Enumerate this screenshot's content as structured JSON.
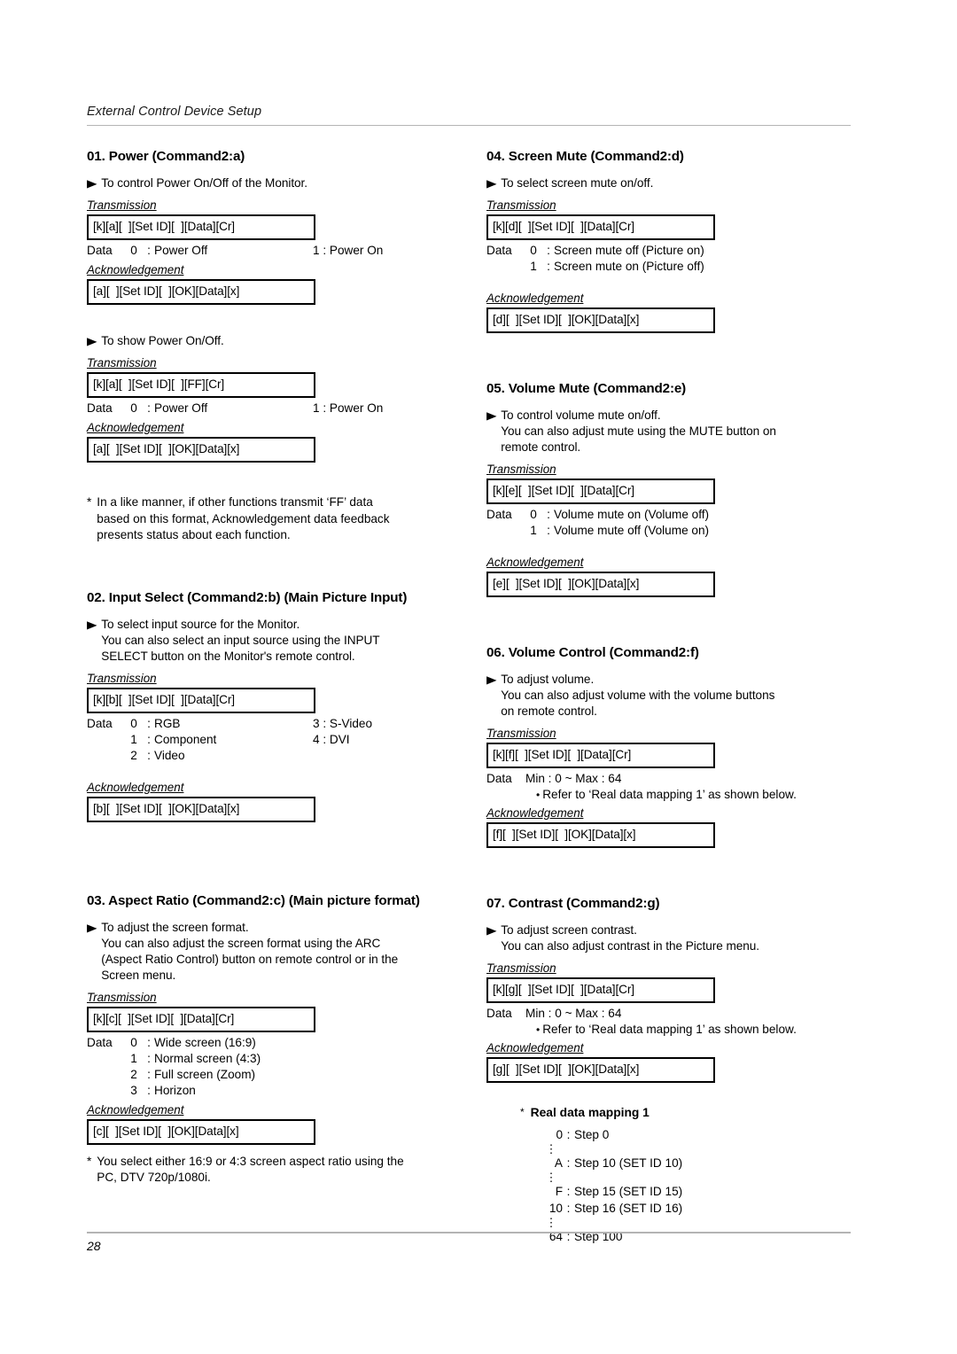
{
  "header": {
    "title": "External Control Device Setup"
  },
  "footer": {
    "page_number": "28"
  },
  "labels": {
    "transmission": "Transmission",
    "acknowledgement": "Acknowledgement",
    "data": "Data",
    "triangle_bullet": "▶",
    "dot_bullet": "•",
    "asterisk": "*",
    "vertical_ellipsis": "⋮"
  },
  "sections": [
    {
      "id": "01",
      "title": "01. Power (Command2:a)",
      "blocks": [
        {
          "intro": [
            "To control Power On/Off of the Monitor."
          ],
          "transmission": "[k][a][  ][Set ID][  ][Data][Cr]",
          "data_label": "Data",
          "data_rows": [
            {
              "key": "0",
              "colon": ":",
              "value": "Power Off",
              "key2": "1",
              "colon2": ":",
              "value2": "Power On"
            }
          ],
          "acknowledgement": "[a][  ][Set ID][  ][OK][Data][x]"
        },
        {
          "intro": [
            "To show Power On/Off."
          ],
          "transmission": "[k][a][  ][Set ID][  ][FF][Cr]",
          "data_label": "Data",
          "data_rows": [
            {
              "key": "0",
              "colon": ":",
              "value": "Power Off",
              "key2": "1",
              "colon2": ":",
              "value2": "Power On"
            }
          ],
          "acknowledgement": "[a][  ][Set ID][  ][OK][Data][x]"
        }
      ],
      "note": {
        "marker": "*",
        "lines": [
          "In a like manner, if other functions transmit ‘FF’ data",
          "based on this format, Acknowledgement data feedback",
          "presents status about each function."
        ]
      }
    },
    {
      "id": "02",
      "title": "02. Input Select (Command2:b) (Main Picture Input)",
      "blocks": [
        {
          "intro": [
            "To select input source for the Monitor.",
            "You can also select an input source using the INPUT",
            "SELECT button on the Monitor's remote control."
          ],
          "transmission": "[k][b][  ][Set ID][  ][Data][Cr]",
          "data_label": "Data",
          "data_rows": [
            {
              "key": "0",
              "colon": ":",
              "value": "RGB",
              "key2": "3",
              "colon2": ":",
              "value2": "S-Video"
            },
            {
              "key": "1",
              "colon": ":",
              "value": "Component",
              "key2": "4",
              "colon2": ":",
              "value2": "DVI"
            },
            {
              "key": "2",
              "colon": ":",
              "value": "Video"
            }
          ],
          "acknowledgement": "[b][  ][Set ID][  ][OK][Data][x]"
        }
      ]
    },
    {
      "id": "03",
      "title": "03. Aspect Ratio (Command2:c) (Main picture format)",
      "blocks": [
        {
          "intro": [
            "To adjust the screen format.",
            "You can also adjust the screen format using the ARC",
            "(Aspect Ratio Control) button on remote control or in the",
            "Screen menu."
          ],
          "transmission": "[k][c][  ][Set ID][  ][Data][Cr]",
          "data_label": "Data",
          "data_rows": [
            {
              "key": "0",
              "colon": ":",
              "value": "Wide screen (16:9)"
            },
            {
              "key": "1",
              "colon": ":",
              "value": "Normal screen (4:3)"
            },
            {
              "key": "2",
              "colon": ":",
              "value": "Full screen (Zoom)"
            },
            {
              "key": "3",
              "colon": ":",
              "value": "Horizon"
            }
          ],
          "acknowledgement": "[c][  ][Set ID][  ][OK][Data][x]"
        }
      ],
      "note": {
        "marker": "*",
        "lines": [
          "You select either 16:9 or 4:3 screen aspect ratio using the",
          "PC, DTV 720p/1080i."
        ]
      }
    },
    {
      "id": "04",
      "title": "04. Screen Mute (Command2:d)",
      "blocks": [
        {
          "intro": [
            "To select screen mute on/off."
          ],
          "transmission": "[k][d][  ][Set ID][  ][Data][Cr]",
          "data_label": "Data",
          "data_rows": [
            {
              "key": "0",
              "colon": ":",
              "value": "Screen mute off (Picture on)"
            },
            {
              "key": "1",
              "colon": ":",
              "value": "Screen mute on (Picture off)"
            }
          ],
          "acknowledgement": "[d][  ][Set ID][  ][OK][Data][x]"
        }
      ]
    },
    {
      "id": "05",
      "title": "05. Volume Mute (Command2:e)",
      "blocks": [
        {
          "intro": [
            "To control volume mute on/off.",
            "You can also adjust mute using the MUTE button on",
            "remote control."
          ],
          "transmission": "[k][e][  ][Set ID][  ][Data][Cr]",
          "data_label": "Data",
          "data_rows": [
            {
              "key": "0",
              "colon": ":",
              "value": "Volume mute on (Volume off)"
            },
            {
              "key": "1",
              "colon": ":",
              "value": "Volume mute off (Volume on)"
            }
          ],
          "acknowledgement": "[e][  ][Set ID][  ][OK][Data][x]"
        }
      ]
    },
    {
      "id": "06",
      "title": "06. Volume Control (Command2:f)",
      "blocks": [
        {
          "intro": [
            "To adjust volume.",
            "You can also adjust volume with the volume buttons",
            "on remote control."
          ],
          "transmission": "[k][f][  ][Set ID][  ][Data][Cr]",
          "data_label": "Data",
          "range": "Min : 0 ~ Max : 64",
          "ref_note": "Refer to ‘Real data mapping 1’ as shown below.",
          "acknowledgement": "[f][  ][Set ID][  ][OK][Data][x]"
        }
      ]
    },
    {
      "id": "07",
      "title": "07. Contrast (Command2:g)",
      "blocks": [
        {
          "intro": [
            "To adjust screen contrast.",
            "You can also adjust contrast in the Picture menu."
          ],
          "transmission": "[k][g][  ][Set ID][  ][Data][Cr]",
          "data_label": "Data",
          "range": "Min : 0 ~ Max : 64",
          "ref_note": "Refer to ‘Real data mapping 1’ as shown below.",
          "acknowledgement": "[g][  ][Set ID][  ][OK][Data][x]"
        }
      ]
    }
  ],
  "real_data_mapping": {
    "marker": "*",
    "title": "Real data mapping 1",
    "rows": [
      {
        "key": "0",
        "colon": ":",
        "value": "Step 0"
      },
      {
        "key": "A",
        "colon": ":",
        "value": "Step 10 (SET ID 10)"
      },
      {
        "key": "F",
        "colon": ":",
        "value": "Step 15 (SET ID 15)"
      },
      {
        "key": "10",
        "colon": ":",
        "value": "Step 16 (SET ID 16)"
      },
      {
        "key": "64",
        "colon": ":",
        "value": "Step 100"
      }
    ]
  }
}
